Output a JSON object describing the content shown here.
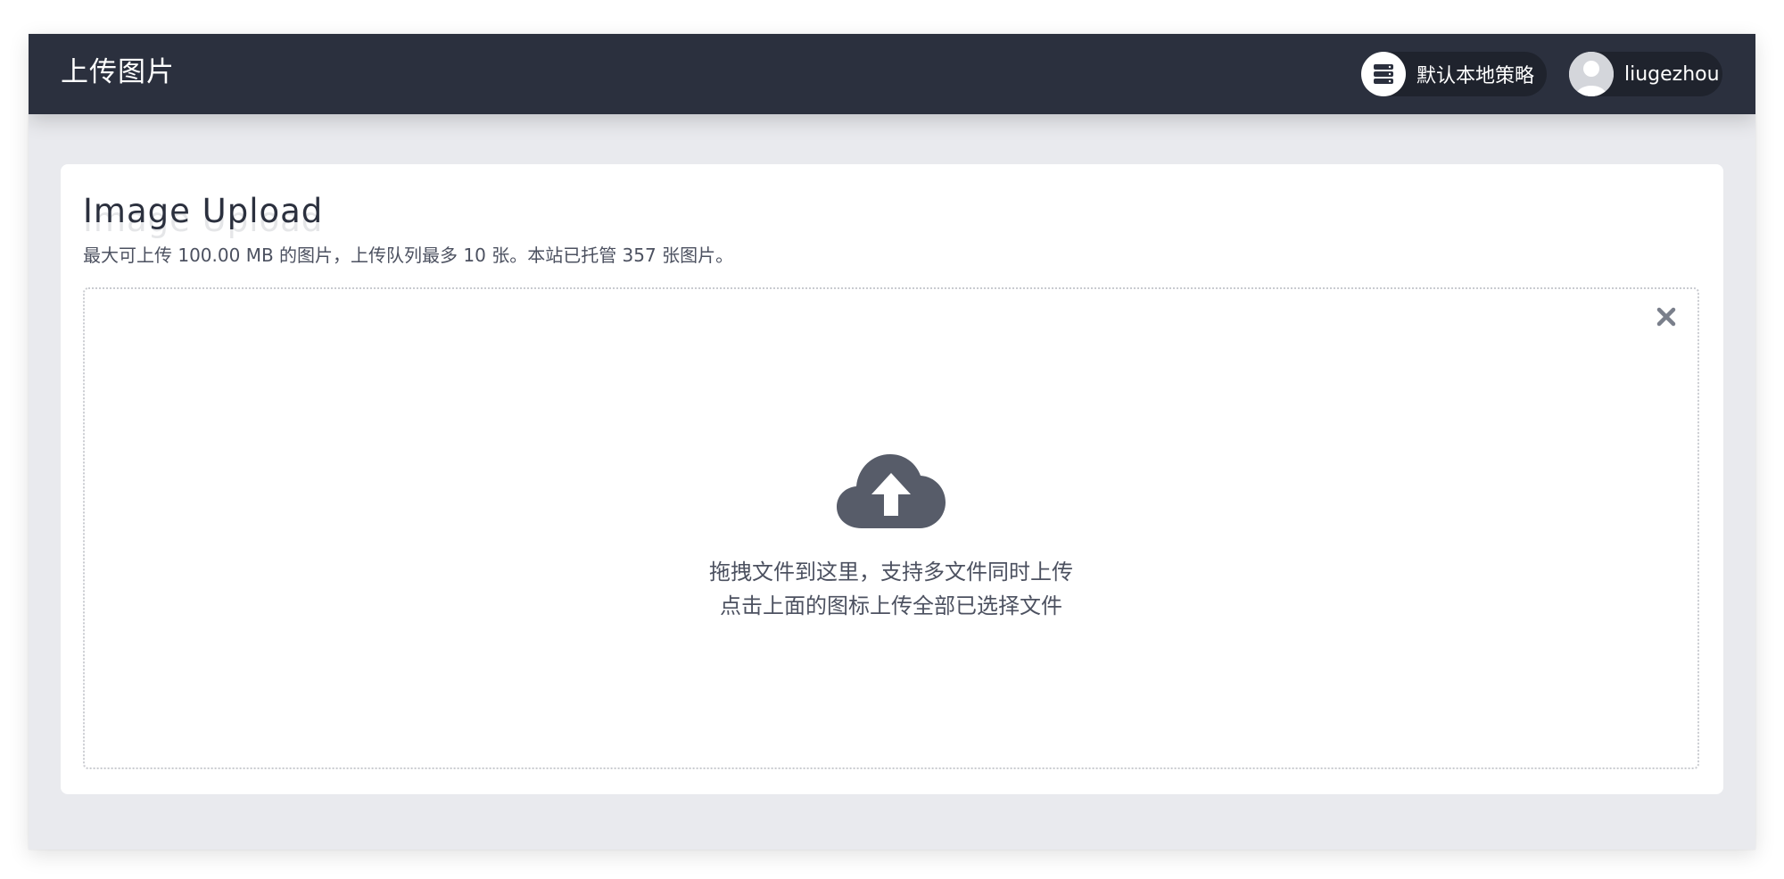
{
  "header": {
    "title": "上传图片",
    "strategy": {
      "label": "默认本地策略",
      "icon": "server-icon"
    },
    "user": {
      "name": "liugezhou",
      "icon": "avatar-icon"
    }
  },
  "upload": {
    "title": "Image Upload",
    "description": "最大可上传 100.00 MB 的图片，上传队列最多 10 张。本站已托管 357 张图片。",
    "dropzone": {
      "hint_line1": "拖拽文件到这里，支持多文件同时上传",
      "hint_line2": "点击上面的图标上传全部已选择文件",
      "upload_icon": "cloud-upload-icon",
      "close_icon": "close-icon"
    }
  },
  "colors": {
    "header_bg": "#2b303e",
    "page_bg": "#e9eaee",
    "card_bg": "#ffffff",
    "icon_gray": "#575c69"
  }
}
